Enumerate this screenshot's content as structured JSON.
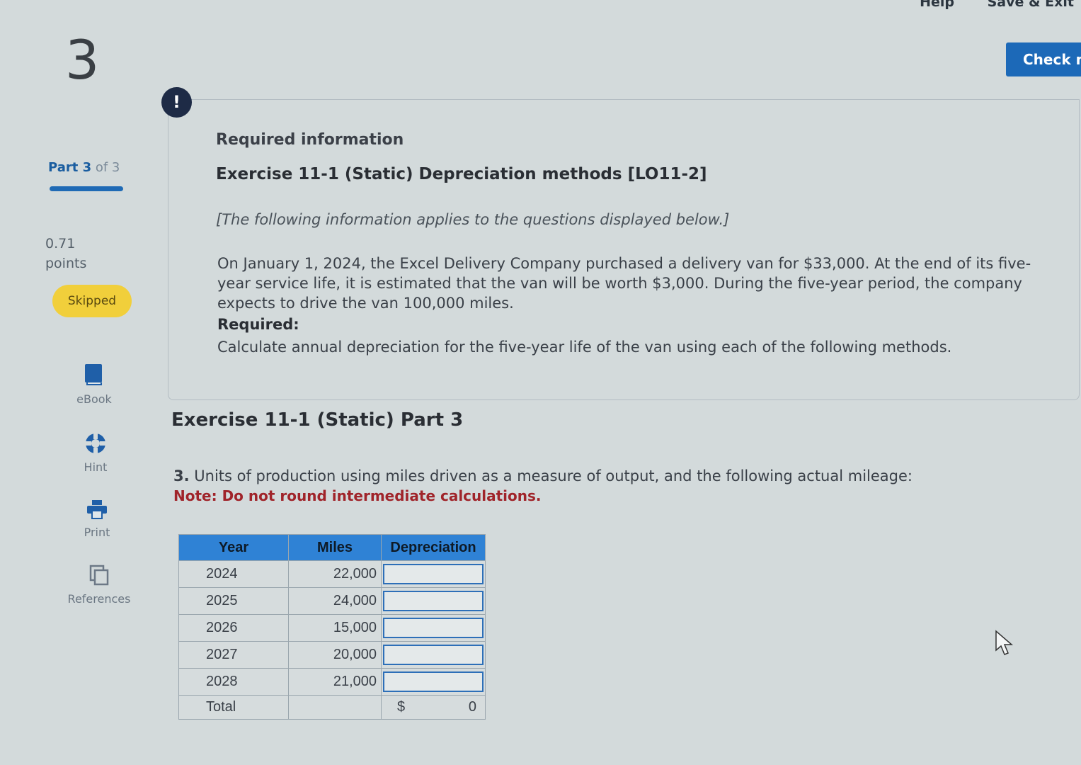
{
  "header": {
    "help_label": "Help",
    "save_exit_label": "Save & Exit",
    "check_label": "Check my work"
  },
  "sidebar": {
    "question_number": "3",
    "part_strong": "Part 3",
    "part_rest": " of 3",
    "points_value": "0.71",
    "points_label": "points",
    "status_badge": "Skipped",
    "tools": [
      {
        "label": "eBook",
        "icon": "book-icon"
      },
      {
        "label": "Hint",
        "icon": "lifebuoy-icon"
      },
      {
        "label": "Print",
        "icon": "printer-icon"
      },
      {
        "label": "References",
        "icon": "copy-icon"
      }
    ]
  },
  "info": {
    "alert_symbol": "!",
    "heading": "Required information",
    "exercise_title": "Exercise 11-1 (Static) Depreciation methods [LO11-2]",
    "applies_note": "[The following information applies to the questions displayed below.]",
    "scenario": "On January 1, 2024, the Excel Delivery Company purchased a delivery van for $33,000. At the end of its five-year service life, it is estimated that the van will be worth $3,000. During the five-year period, the company expects to drive the van 100,000 miles.",
    "required_label": "Required:",
    "instruction": "Calculate annual depreciation for the five-year life of the van using each of the following methods."
  },
  "question": {
    "part_title": "Exercise 11-1 (Static) Part 3",
    "number": "3.",
    "text": " Units of production using miles driven as a measure of output, and the following actual mileage:",
    "note": "Note: Do not round intermediate calculations."
  },
  "table": {
    "headers": [
      "Year",
      "Miles",
      "Depreciation"
    ],
    "rows": [
      {
        "year": "2024",
        "miles": "22,000"
      },
      {
        "year": "2025",
        "miles": "24,000"
      },
      {
        "year": "2026",
        "miles": "15,000"
      },
      {
        "year": "2027",
        "miles": "20,000"
      },
      {
        "year": "2028",
        "miles": "21,000"
      }
    ],
    "total_label": "Total",
    "total_currency": "$",
    "total_value": "0"
  }
}
